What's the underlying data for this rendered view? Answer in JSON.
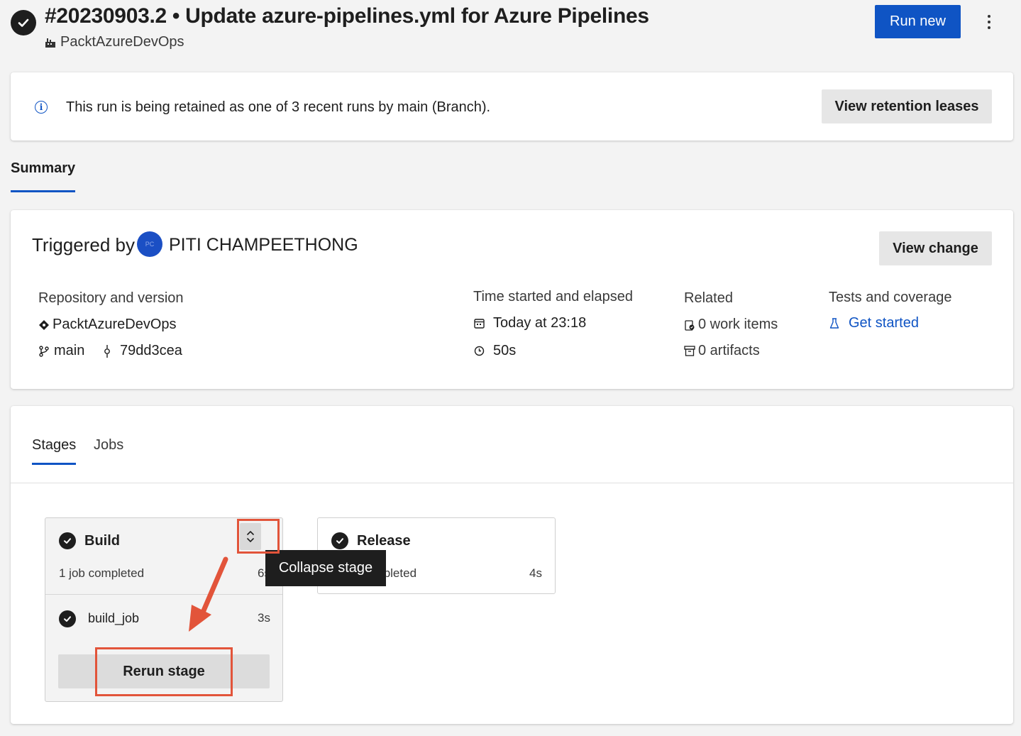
{
  "header": {
    "title": "#20230903.2 • Update azure-pipelines.yml for Azure Pipelines",
    "project": "PacktAzureDevOps",
    "run_new_label": "Run new",
    "more_icon": "more-vertical-icon"
  },
  "retention": {
    "message": "This run is being retained as one of 3 recent runs by main (Branch).",
    "button_label": "View retention leases"
  },
  "tabs": {
    "summary_label": "Summary"
  },
  "summary": {
    "triggered_by_label": "Triggered by",
    "avatar_initials": "PC",
    "user_name": "PITI CHAMPEETHONG",
    "view_change_label": "View change",
    "repo": {
      "label": "Repository and version",
      "name": "PacktAzureDevOps",
      "branch": "main",
      "commit": "79dd3cea"
    },
    "time": {
      "label": "Time started and elapsed",
      "started": "Today at 23:18",
      "elapsed": "50s"
    },
    "related": {
      "label": "Related",
      "work_items": "0 work items",
      "artifacts": "0 artifacts"
    },
    "tests": {
      "label": "Tests and coverage",
      "link": "Get started"
    }
  },
  "stages_panel": {
    "tab_stages": "Stages",
    "tab_jobs": "Jobs",
    "build": {
      "name": "Build",
      "status": "1 job completed",
      "duration": "6s",
      "job_name": "build_job",
      "job_duration": "3s",
      "rerun_label": "Rerun stage"
    },
    "release": {
      "name": "Release",
      "status": "1 job completed",
      "duration": "4s"
    },
    "tooltip": "Collapse stage"
  },
  "colors": {
    "accent": "#0f54c4",
    "annotation": "#e2543a",
    "success": "#1e1e1e"
  }
}
